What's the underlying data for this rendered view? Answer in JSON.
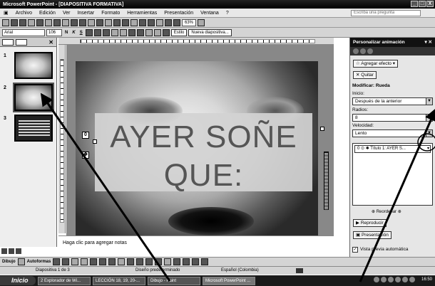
{
  "window": {
    "title": "Microsoft PowerPoint - [DIAPOSITIVA FORMATIVA]",
    "buttons": [
      "_",
      "□",
      "X"
    ]
  },
  "menu": {
    "items": [
      "Archivo",
      "Edición",
      "Ver",
      "Insertar",
      "Formato",
      "Herramientas",
      "Presentación",
      "Ventana",
      "?"
    ],
    "ask_placeholder": "Escriba una pregunta"
  },
  "toolbar": {
    "zoom": "63%",
    "font": "Arial",
    "size": "106",
    "bold": "N",
    "italic": "K",
    "shadow": "S",
    "style_label": "Estilo",
    "new_slide": "Nueva diapositiva..."
  },
  "thumbnails": [
    {
      "num": "1"
    },
    {
      "num": "2"
    },
    {
      "num": "3"
    }
  ],
  "slide": {
    "title_line1": "AYER SOÑE",
    "title_line2": "QUE:",
    "anim_tag": "0"
  },
  "notes": {
    "placeholder": "Haga clic para agregar notas"
  },
  "drawing": {
    "draw_label": "Dibujo",
    "autoshapes_label": "Autoformas"
  },
  "status": {
    "slide": "Diapositiva 1 de 3",
    "design": "Diseño predeterminado",
    "language": "Español (Colombia)"
  },
  "taskbar": {
    "start": "Inicio",
    "tasks": [
      "2 Explorador de Wi...",
      "LECCIÓN 18, 19, 20-...",
      "Dibujo - Paint",
      "Microsoft PowerPoint ..."
    ],
    "clock": "16:50"
  },
  "taskpane": {
    "title": "Personalizar animación",
    "add_effect": "Agregar efecto",
    "remove": "Quitar",
    "modify": "Modificar: Rueda",
    "start_label": "Inicio:",
    "start_value": "Después de la anterior",
    "spokes_label": "Radios:",
    "spokes_value": "8",
    "speed_label": "Velocidad:",
    "speed_value": "Lento",
    "list_item": "Título 1: AYER S...",
    "list_item_index": "0",
    "reorder": "Reordenar",
    "play": "Reproducir",
    "slideshow": "Presentación",
    "autopreview": "Vista previa automática"
  }
}
